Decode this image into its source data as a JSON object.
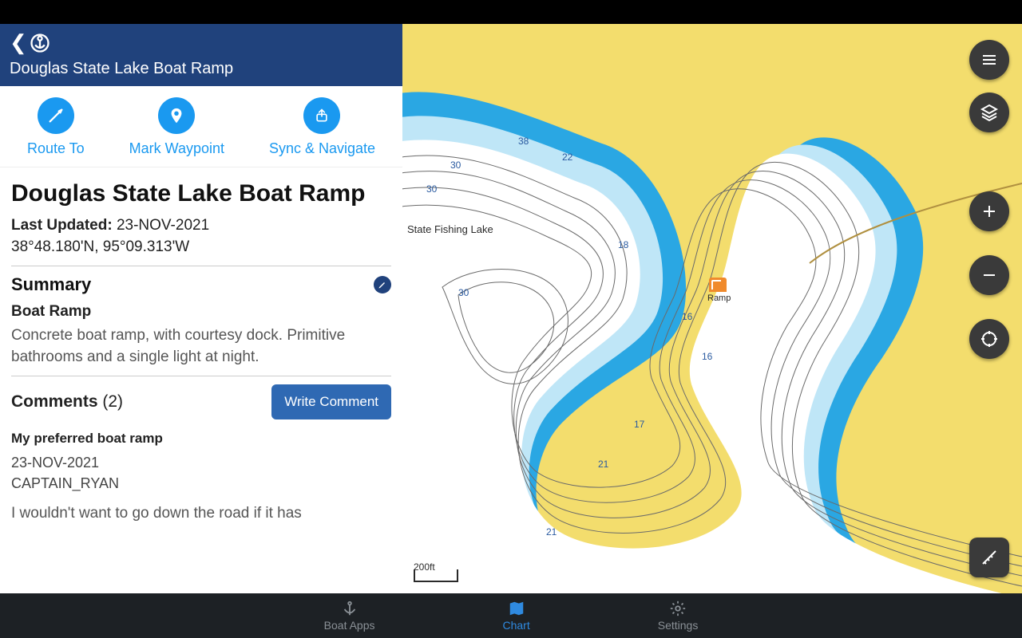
{
  "header": {
    "title": "Douglas State Lake Boat Ramp"
  },
  "actions": {
    "route": "Route To",
    "mark": "Mark Waypoint",
    "sync": "Sync & Navigate"
  },
  "poi": {
    "name": "Douglas State Lake Boat Ramp",
    "updated_label": "Last Updated:",
    "updated": "23-NOV-2021",
    "coords": "38°48.180'N, 95°09.313'W"
  },
  "summary": {
    "heading": "Summary",
    "type": "Boat Ramp",
    "text": "Concrete boat ramp, with courtesy dock. Primitive bathrooms and a single light at night."
  },
  "comments": {
    "heading": "Comments",
    "count": "(2)",
    "write_label": "Write Comment",
    "items": [
      {
        "title": "My preferred boat ramp",
        "date": "23-NOV-2021",
        "author": "CAPTAIN_RYAN",
        "body": "I wouldn't want to go down the road if it has"
      }
    ]
  },
  "map": {
    "lake_label": "State Fishing Lake",
    "ramp_label": "Ramp",
    "scale_label": "200ft",
    "depth_labels": [
      "30",
      "30",
      "38",
      "22",
      "18",
      "16",
      "16",
      "17",
      "21",
      "21",
      "30"
    ]
  },
  "nav": {
    "boat_apps": "Boat Apps",
    "chart": "Chart",
    "settings": "Settings"
  }
}
